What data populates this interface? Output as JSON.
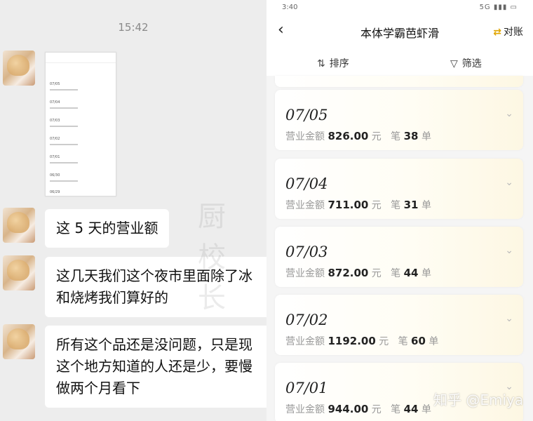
{
  "chat": {
    "time": "15:42",
    "messages": [
      "这 5 天的营业额",
      "这几天我们这个夜市里面除了冰",
      "和烧烤我们算好的",
      "所有这个品还是没问题，只是现",
      "这个地方知道的人还是少，要慢",
      "做两个月看下"
    ],
    "thumbnail": {
      "dates": [
        "07/05",
        "07/04",
        "07/03",
        "07/02",
        "07/01",
        "06/30",
        "06/29"
      ]
    },
    "watermark": "厨校长"
  },
  "app": {
    "status_time": "3:40",
    "status_icons": "5G ▮▮▮ ▭",
    "back_icon": "chevron-left-icon",
    "title": "本体学霸芭虾滑",
    "bill_label": "对账",
    "sort_label": "排序",
    "filter_label": "筛选",
    "amount_prefix": "营业金额",
    "amount_unit": "元",
    "count_prefix": "笔",
    "count_unit": "单",
    "records": [
      {
        "date": "07/05",
        "amount": "826.00",
        "count": "38"
      },
      {
        "date": "07/04",
        "amount": "711.00",
        "count": "31"
      },
      {
        "date": "07/03",
        "amount": "872.00",
        "count": "44"
      },
      {
        "date": "07/02",
        "amount": "1192.00",
        "count": "60"
      },
      {
        "date": "07/01",
        "amount": "944.00",
        "count": "44"
      }
    ]
  },
  "watermark": "知乎 @Emiya"
}
